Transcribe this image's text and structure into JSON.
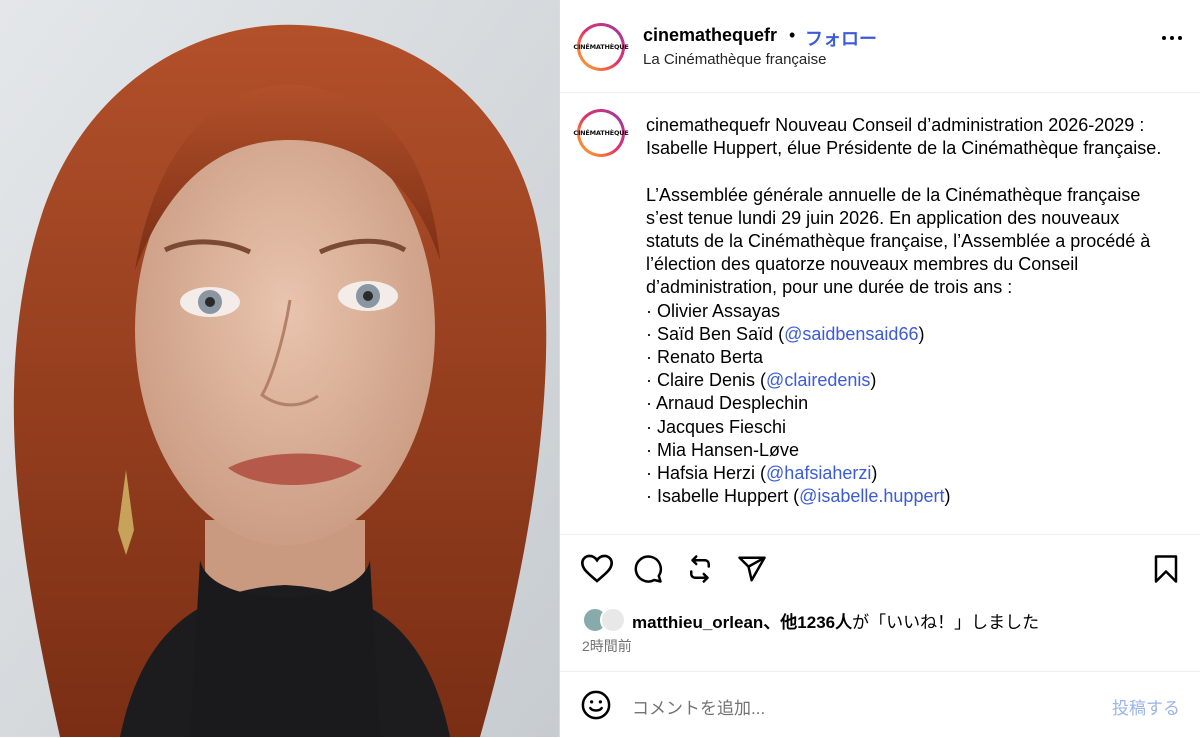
{
  "post": {
    "username": "cinemathequefr",
    "separator": "•",
    "follow_label": "フォロー",
    "subtitle": "La Cinémathèque française",
    "avatar_text": "CINÉMATHÈQUE"
  },
  "caption": {
    "username": "cinemathequefr",
    "lines": [
      {
        "t": "Nouveau Conseil d’administration 2026-2029 : Isabelle Huppert, élue Présidente de la Cinémathèque française."
      },
      {
        "t": ""
      },
      {
        "t": "L’Assemblée générale annuelle de la Cinémathèque française s’est tenue lundi 29 juin 2026. En application des nouveaux statuts de la Cinémathèque française, l’Assemblée a procédé à l’élection des quatorze nouveaux membres du Conseil d’administration, pour une durée de trois ans :"
      }
    ],
    "members": [
      {
        "name": "Olivier Assayas",
        "handle": ""
      },
      {
        "name": "Saïd Ben Saïd",
        "handle": "@saidbensaid66"
      },
      {
        "name": "Renato Berta",
        "handle": ""
      },
      {
        "name": "Claire Denis",
        "handle": "@clairedenis"
      },
      {
        "name": "Arnaud Desplechin",
        "handle": ""
      },
      {
        "name": "Jacques Fieschi",
        "handle": ""
      },
      {
        "name": "Mia Hansen-Løve",
        "handle": ""
      },
      {
        "name": "Hafsia Herzi",
        "handle": "@hafsiaherzi"
      },
      {
        "name": "Isabelle Huppert",
        "handle": "@isabelle.huppert"
      }
    ]
  },
  "likes": {
    "user": "matthieu_orlean",
    "others": "、他1236人",
    "suffix": "が「いいね！」しました"
  },
  "time": "2時間前",
  "comment": {
    "placeholder": "コメントを追加...",
    "post_label": "投稿する"
  },
  "icons": [
    "heart-icon",
    "comment-icon",
    "repost-icon",
    "share-icon",
    "bookmark-icon",
    "more-icon",
    "emoji-icon"
  ],
  "colors": {
    "link": "#3b5bdb",
    "muted": "#737373",
    "post_disabled": "#9bb5ea"
  }
}
